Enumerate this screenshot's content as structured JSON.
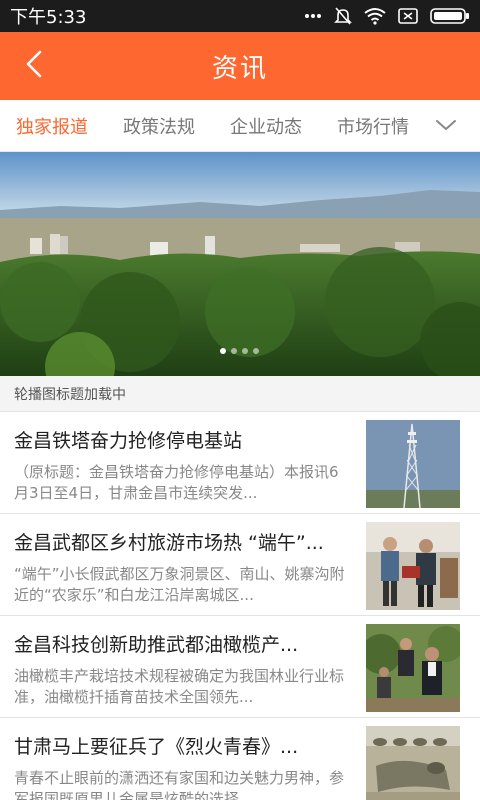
{
  "status_bar": {
    "time": "下午5:33",
    "icons": [
      "dots-icon",
      "mute-icon",
      "wifi-icon",
      "sim-icon",
      "battery-icon"
    ]
  },
  "header": {
    "title": "资讯",
    "back_icon": "chevron-left-icon"
  },
  "tabs": {
    "items": [
      {
        "label": "独家报道",
        "active": true
      },
      {
        "label": "政策法规",
        "active": false
      },
      {
        "label": "企业动态",
        "active": false
      },
      {
        "label": "市场行情",
        "active": false
      }
    ],
    "expand_icon": "chevron-down-icon"
  },
  "banner": {
    "caption": "轮播图标题加载中",
    "total_slides": 4,
    "current_slide": 1
  },
  "news": [
    {
      "title": "金昌铁塔奋力抢修停电基站",
      "summary": "（原标题：金昌铁塔奋力抢修停电基站）本报讯6月3日至4日，甘肃金昌市连续突发..."
    },
    {
      "title": "金昌武都区乡村旅游市场热 “端午”...",
      "summary": "“端午”小长假武都区万象洞景区、南山、姚寨沟附近的“农家乐”和白龙江沿岸离城区..."
    },
    {
      "title": "金昌科技创新助推武都油橄榄产...",
      "summary": "油橄榄丰产栽培技术规程被确定为我国林业行业标准，油橄榄扦插育苗技术全国领先..."
    },
    {
      "title": "甘肃马上要征兵了《烈火青春》...",
      "summary": "青春不止眼前的潇洒还有家国和边关魅力男神，参军报国既原男儿金属是炫酷的选择..."
    }
  ],
  "colors": {
    "accent": "#fe6730",
    "status_bar": "#1c1c1c"
  }
}
